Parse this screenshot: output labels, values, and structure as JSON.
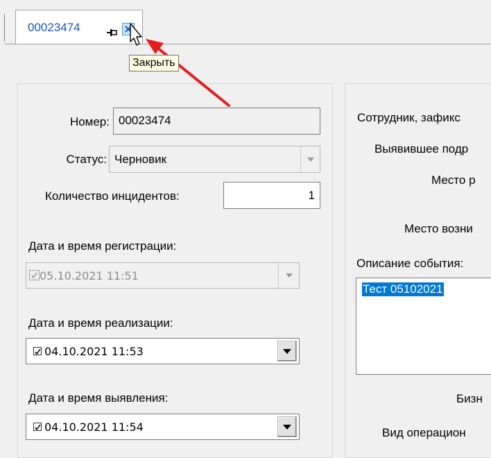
{
  "tab": {
    "title": "00023474",
    "pin_glyph": "pin-icon",
    "close_glyph": "close-icon",
    "tooltip": "Закрыть"
  },
  "left_panel": {
    "number_label": "Номер:",
    "number_value": "00023474",
    "status_label": "Статус:",
    "status_value": "Черновик",
    "incidents_label": "Количество инцидентов:",
    "incidents_value": "1",
    "reg_label": "Дата и время регистрации:",
    "reg_value": "05.10.2021 11:51",
    "impl_label": "Дата и время реализации:",
    "impl_value": "04.10.2021 11:53",
    "detect_label": "Дата и время выявления:",
    "detect_value": "04.10.2021 11:54"
  },
  "right_panel": {
    "employee_label": "Сотрудник, зафикс",
    "dept_label": "Выявившее подр",
    "place_label": "Место р",
    "origin_label": "Место возни",
    "description_label": "Описание события:",
    "description_value": "Тест 05102021",
    "business_label": "Бизн",
    "operational_label": "Вид операцион"
  },
  "colors": {
    "tab_text": "#1a56c4",
    "selection": "#0078d7",
    "arrow": "#e81c1c",
    "tooltip_bg": "#ffffe1"
  }
}
